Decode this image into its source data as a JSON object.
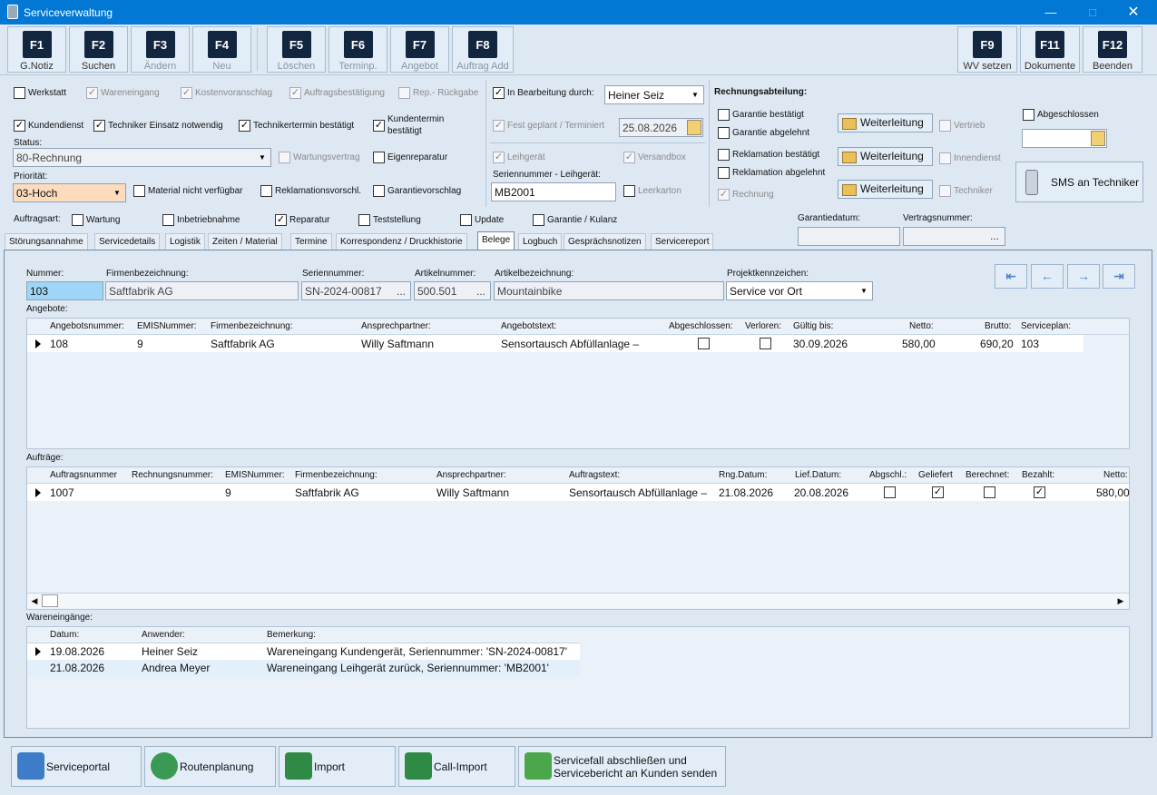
{
  "window": {
    "title": "Serviceverwaltung"
  },
  "toolbar": [
    {
      "key": "F1",
      "label": "G.Notiz"
    },
    {
      "key": "F2",
      "label": "Suchen"
    },
    {
      "key": "F3",
      "label": "Ändern"
    },
    {
      "key": "F4",
      "label": "Neu"
    },
    {
      "key": "F5",
      "label": "Löschen"
    },
    {
      "key": "F6",
      "label": "Terminp."
    },
    {
      "key": "F7",
      "label": "Angebot"
    },
    {
      "key": "F8",
      "label": "Auftrag Add"
    },
    {
      "key": "F9",
      "label": "WV setzen"
    },
    {
      "key": "F11",
      "label": "Dokumente"
    },
    {
      "key": "F12",
      "label": "Beenden"
    }
  ],
  "flags": {
    "werkstatt": "Werkstatt",
    "wareneingang": "Wareneingang",
    "kostenvoranschlag": "Kostenvoranschlag",
    "auftragsbestaetigung": "Auftragsbestätigung",
    "rep_rueckgabe": "Rep.- Rückgabe",
    "kundendienst": "Kundendienst",
    "techniker_einsatz": "Techniker Einsatz notwendig",
    "technikertermin": "Technikertermin bestätigt",
    "kundentermin1": "Kundentermin",
    "kundentermin2": "bestätigt",
    "wartungsvertrag": "Wartungsvertrag",
    "eigenreparatur": "Eigenreparatur",
    "material": "Material nicht verfügbar",
    "reklamationsvorschl": "Reklamationsvorschl.",
    "garantievorschlag": "Garantievorschlag"
  },
  "status": {
    "label": "Status:",
    "value": "80-Rechnung"
  },
  "prioritaet": {
    "label": "Priorität:",
    "value": "03-Hoch"
  },
  "bearbeitung": {
    "label": "In Bearbeitung durch:",
    "value": "Heiner Seiz",
    "fest": "Fest geplant / Terminiert",
    "date": "25.08.2026",
    "leihgeraet": "Leihgerät",
    "versandbox": "Versandbox",
    "sn_label": "Seriennummer - Leihgerät:",
    "sn_value": "MB2001",
    "leerkarton": "Leerkarton"
  },
  "rechnung": {
    "header": "Rechnungsabteilung:",
    "garantie_best": "Garantie bestätigt",
    "garantie_abg": "Garantie abgelehnt",
    "reklamation_best": "Reklamation bestätigt",
    "reklamation_abg": "Reklamation abgelehnt",
    "rechnung": "Rechnung",
    "weiter": "Weiterleitung",
    "vertrieb": "Vertrieb",
    "innendienst": "Innendienst",
    "techniker": "Techniker",
    "abgeschlossen": "Abgeschlossen",
    "sms": "SMS an Techniker"
  },
  "auftragsart": {
    "label": "Auftragsart:",
    "wartung": "Wartung",
    "inbetriebnahme": "Inbetriebnahme",
    "reparatur": "Reparatur",
    "teststellung": "Teststellung",
    "update": "Update",
    "garantie": "Garantie / Kulanz"
  },
  "garantiedatum": {
    "label": "Garantiedatum:"
  },
  "vertragsnummer": {
    "label": "Vertragsnummer:",
    "btn": "..."
  },
  "tabs": [
    "Störungsannahme",
    "Servicedetails",
    "Logistik",
    "Zeiten / Material",
    "Termine",
    "Korrespondenz / Druckhistorie",
    "Belege",
    "Logbuch",
    "Gesprächsnotizen",
    "Servicereport"
  ],
  "belege": {
    "nummer": {
      "label": "Nummer:",
      "value": "103"
    },
    "firma": {
      "label": "Firmenbezeichnung:",
      "value": "Saftfabrik AG"
    },
    "serie": {
      "label": "Seriennummer:",
      "value": "SN-2024-00817"
    },
    "artnr": {
      "label": "Artikelnummer:",
      "value": "500.501"
    },
    "artbez": {
      "label": "Artikelbezeichnung:",
      "value": "Mountainbike"
    },
    "projekt": {
      "label": "Projektkennzeichen:",
      "value": "Service vor Ort"
    },
    "angebote_label": "Angebote:",
    "angebote_cols": [
      "Angebotsnummer:",
      "EMISNummer:",
      "Firmenbezeichnung:",
      "Ansprechpartner:",
      "Angebotstext:",
      "Abgeschlossen:",
      "Verloren:",
      "Gültig bis:",
      "Netto:",
      "Brutto:",
      "Serviceplan:"
    ],
    "angebote_row": {
      "nr": "108",
      "emis": "9",
      "firma": "Saftfabrik AG",
      "ansprech": "Willy Saftmann",
      "text": "Sensortausch Abfüllanlage –",
      "gueltig": "30.09.2026",
      "netto": "580,00",
      "brutto": "690,20",
      "plan": "103"
    },
    "auftraege_label": "Aufträge:",
    "auftraege_cols": [
      "Auftragsnummer",
      "Rechnungsnummer:",
      "EMISNummer:",
      "Firmenbezeichnung:",
      "Ansprechpartner:",
      "Auftragstext:",
      "Rng.Datum:",
      "Lief.Datum:",
      "Abgschl.:",
      "Geliefert",
      "Berechnet:",
      "Bezahlt:",
      "Netto:"
    ],
    "auftraege_row": {
      "nr": "1007",
      "emis": "9",
      "firma": "Saftfabrik AG",
      "ansprech": "Willy Saftmann",
      "text": "Sensortausch Abfüllanlage –",
      "rng": "21.08.2026",
      "lief": "20.08.2026",
      "netto": "580,00"
    },
    "waren_label": "Wareneingänge:",
    "waren_cols": [
      "Datum:",
      "Anwender:",
      "Bemerkung:"
    ],
    "waren_rows": [
      {
        "datum": "19.08.2026",
        "anwender": "Heiner Seiz",
        "bem": "Wareneingang Kundengerät, Seriennummer: 'SN-2024-00817'"
      },
      {
        "datum": "21.08.2026",
        "anwender": "Andrea Meyer",
        "bem": "Wareneingang Leihgerät zurück, Seriennummer: 'MB2001'"
      }
    ]
  },
  "bottom": {
    "serviceportal": "Serviceportal",
    "routen": "Routenplanung",
    "import": "Import",
    "callimport": "Call-Import",
    "abschl1": "Servicefall abschließen und",
    "abschl2": "Servicebericht an Kunden senden"
  },
  "colors": {
    "titlebar": "#0078d4",
    "fkey": "#13263f",
    "background": "#dde8f3",
    "priority": "#fcdcbc",
    "selected_input": "#9fd6f7"
  }
}
